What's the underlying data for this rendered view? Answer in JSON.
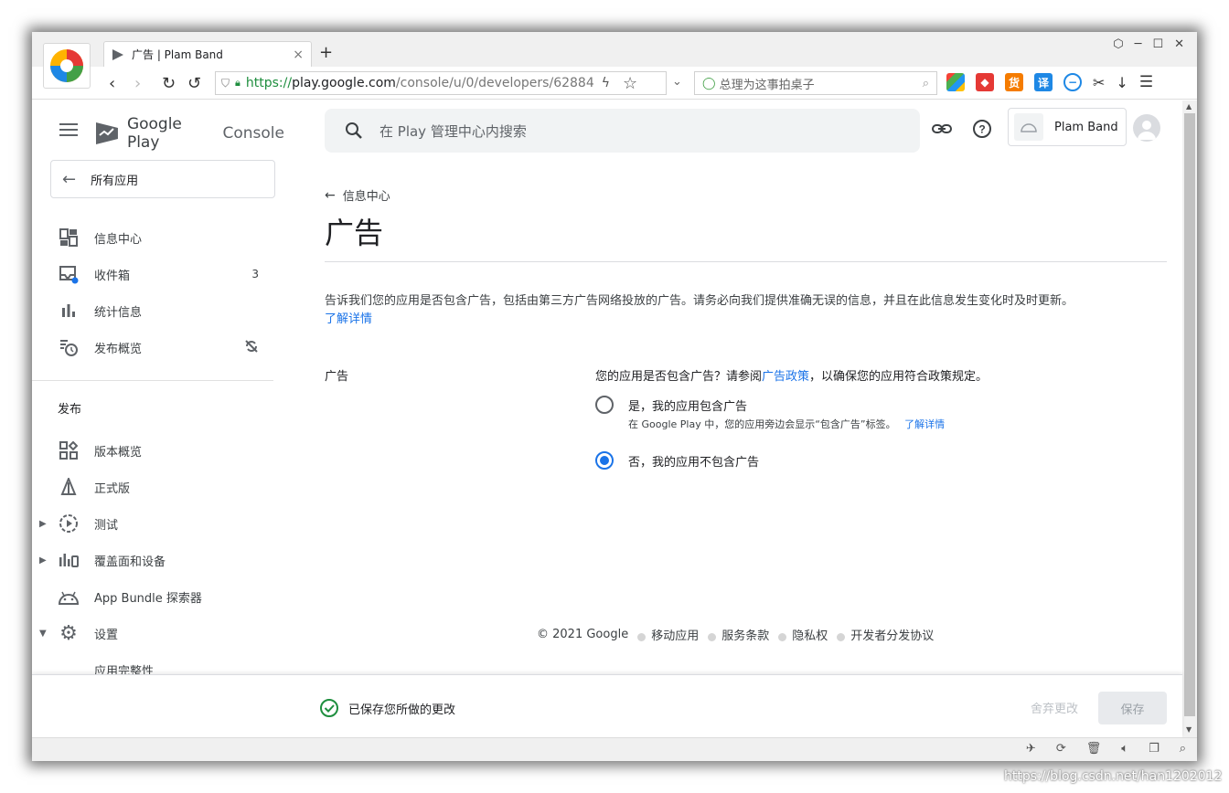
{
  "browser": {
    "tab_title": "广告 | Plam Band",
    "tab_close": "×",
    "new_tab": "+",
    "url_scheme": "https://",
    "url_host": "play.google.com",
    "url_path": "/console/u/0/developers/62884",
    "search_placeholder": "总理为这事拍桌子",
    "ext_labels": [
      "货",
      "译"
    ]
  },
  "sidebar": {
    "brand_google": "Google Play",
    "brand_console": "Console",
    "all_apps": "所有应用",
    "items": [
      {
        "label": "信息中心"
      },
      {
        "label": "收件箱",
        "badge": "3"
      },
      {
        "label": "统计信息"
      },
      {
        "label": "发布概览"
      }
    ],
    "section_release": "发布",
    "release_items": [
      {
        "label": "版本概览"
      },
      {
        "label": "正式版"
      },
      {
        "label": "测试"
      },
      {
        "label": "覆盖面和设备"
      },
      {
        "label": "App Bundle 探索器"
      },
      {
        "label": "设置"
      },
      {
        "label": "应用完整性"
      }
    ]
  },
  "header": {
    "search_placeholder": "在 Play 管理中心内搜索",
    "account_name": "Plam Band"
  },
  "main": {
    "breadcrumb": "信息中心",
    "title": "广告",
    "description": "告诉我们您的应用是否包含广告，包括由第三方广告网络投放的广告。请务必向我们提供准确无误的信息，并且在此信息发生变化时及时更新。",
    "learn_more": "了解详情",
    "field_label": "广告",
    "question_prefix": "您的应用是否包含广告？请参阅",
    "question_link": "广告政策",
    "question_suffix": "，以确保您的应用符合政策规定。",
    "option_yes": "是，我的应用包含广告",
    "option_yes_help": "在 Google Play 中，您的应用旁边会显示“包含广告”标签。",
    "option_yes_learn": "了解详情",
    "option_no": "否，我的应用不包含广告",
    "selected": "no"
  },
  "footer": {
    "copyright": "© 2021 Google",
    "links": [
      "移动应用",
      "服务条款",
      "隐私权",
      "开发者分发协议"
    ]
  },
  "savebar": {
    "status": "已保存您所做的更改",
    "discard": "舍弃更改",
    "save": "保存"
  },
  "watermark": "https://blog.csdn.net/han1202012",
  "colors": {
    "accent": "#1a73e8",
    "success": "#1e8e3e"
  }
}
